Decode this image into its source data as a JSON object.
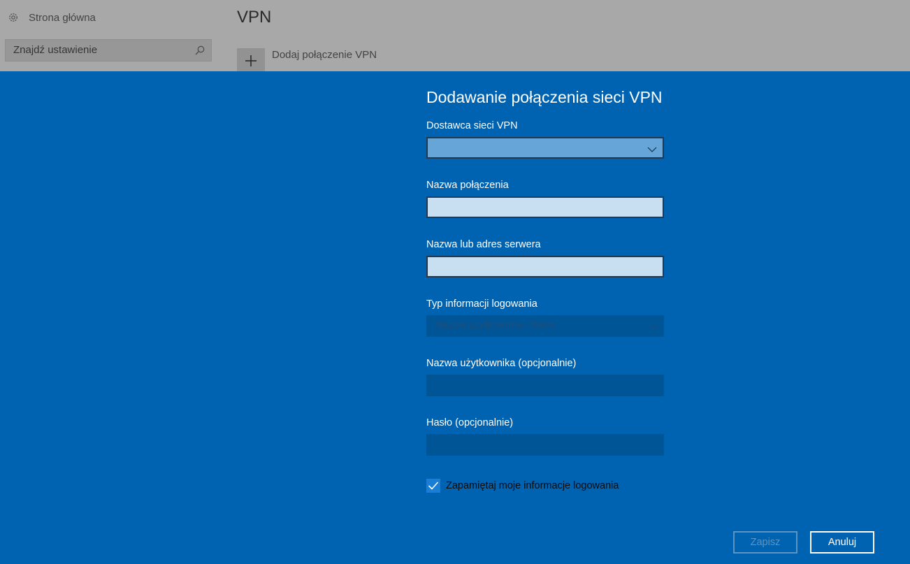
{
  "background": {
    "sidebar": {
      "home_label": "Strona główna",
      "home_icon": "gear-icon",
      "search_placeholder": "Znajdź ustawienie",
      "search_icon": "search-icon"
    },
    "main": {
      "title": "VPN",
      "add_vpn_label": "Dodaj połączenie VPN",
      "add_vpn_icon": "plus-icon"
    }
  },
  "dialog": {
    "title": "Dodawanie połączenia sieci VPN",
    "provider": {
      "label": "Dostawca sieci VPN",
      "value": ""
    },
    "connection_name": {
      "label": "Nazwa połączenia",
      "value": ""
    },
    "server": {
      "label": "Nazwa lub adres serwera",
      "value": ""
    },
    "signin_type": {
      "label": "Typ informacji logowania",
      "value": "Nazwa użytkownika i hasło"
    },
    "username": {
      "label": "Nazwa użytkownika (opcjonalnie)",
      "value": ""
    },
    "password": {
      "label": "Hasło (opcjonalnie)",
      "value": ""
    },
    "remember": {
      "label": "Zapamiętaj moje informacje logowania",
      "checked": true
    },
    "buttons": {
      "save": "Zapisz",
      "cancel": "Anuluj"
    }
  },
  "colors": {
    "dialog_bg": "#0063b1",
    "active_select_bg": "#66a5d8",
    "input_bg": "#c8dff1",
    "disabled_bg": "#005597",
    "checkbox_bg": "#1a7fd4"
  }
}
